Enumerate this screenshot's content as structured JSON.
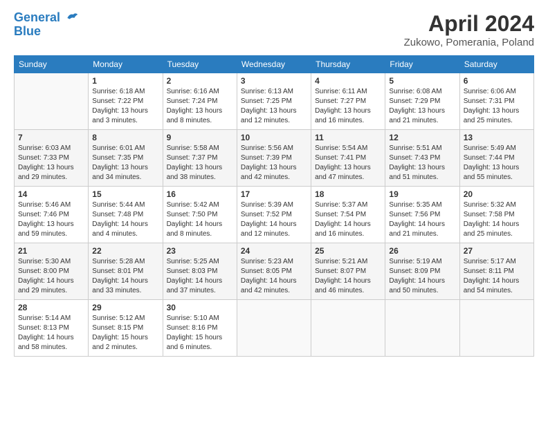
{
  "header": {
    "logo_line1": "General",
    "logo_line2": "Blue",
    "title": "April 2024",
    "subtitle": "Zukowo, Pomerania, Poland"
  },
  "calendar": {
    "days_of_week": [
      "Sunday",
      "Monday",
      "Tuesday",
      "Wednesday",
      "Thursday",
      "Friday",
      "Saturday"
    ],
    "weeks": [
      [
        {
          "day": "",
          "info": ""
        },
        {
          "day": "1",
          "info": "Sunrise: 6:18 AM\nSunset: 7:22 PM\nDaylight: 13 hours\nand 3 minutes."
        },
        {
          "day": "2",
          "info": "Sunrise: 6:16 AM\nSunset: 7:24 PM\nDaylight: 13 hours\nand 8 minutes."
        },
        {
          "day": "3",
          "info": "Sunrise: 6:13 AM\nSunset: 7:25 PM\nDaylight: 13 hours\nand 12 minutes."
        },
        {
          "day": "4",
          "info": "Sunrise: 6:11 AM\nSunset: 7:27 PM\nDaylight: 13 hours\nand 16 minutes."
        },
        {
          "day": "5",
          "info": "Sunrise: 6:08 AM\nSunset: 7:29 PM\nDaylight: 13 hours\nand 21 minutes."
        },
        {
          "day": "6",
          "info": "Sunrise: 6:06 AM\nSunset: 7:31 PM\nDaylight: 13 hours\nand 25 minutes."
        }
      ],
      [
        {
          "day": "7",
          "info": "Sunrise: 6:03 AM\nSunset: 7:33 PM\nDaylight: 13 hours\nand 29 minutes."
        },
        {
          "day": "8",
          "info": "Sunrise: 6:01 AM\nSunset: 7:35 PM\nDaylight: 13 hours\nand 34 minutes."
        },
        {
          "day": "9",
          "info": "Sunrise: 5:58 AM\nSunset: 7:37 PM\nDaylight: 13 hours\nand 38 minutes."
        },
        {
          "day": "10",
          "info": "Sunrise: 5:56 AM\nSunset: 7:39 PM\nDaylight: 13 hours\nand 42 minutes."
        },
        {
          "day": "11",
          "info": "Sunrise: 5:54 AM\nSunset: 7:41 PM\nDaylight: 13 hours\nand 47 minutes."
        },
        {
          "day": "12",
          "info": "Sunrise: 5:51 AM\nSunset: 7:43 PM\nDaylight: 13 hours\nand 51 minutes."
        },
        {
          "day": "13",
          "info": "Sunrise: 5:49 AM\nSunset: 7:44 PM\nDaylight: 13 hours\nand 55 minutes."
        }
      ],
      [
        {
          "day": "14",
          "info": "Sunrise: 5:46 AM\nSunset: 7:46 PM\nDaylight: 13 hours\nand 59 minutes."
        },
        {
          "day": "15",
          "info": "Sunrise: 5:44 AM\nSunset: 7:48 PM\nDaylight: 14 hours\nand 4 minutes."
        },
        {
          "day": "16",
          "info": "Sunrise: 5:42 AM\nSunset: 7:50 PM\nDaylight: 14 hours\nand 8 minutes."
        },
        {
          "day": "17",
          "info": "Sunrise: 5:39 AM\nSunset: 7:52 PM\nDaylight: 14 hours\nand 12 minutes."
        },
        {
          "day": "18",
          "info": "Sunrise: 5:37 AM\nSunset: 7:54 PM\nDaylight: 14 hours\nand 16 minutes."
        },
        {
          "day": "19",
          "info": "Sunrise: 5:35 AM\nSunset: 7:56 PM\nDaylight: 14 hours\nand 21 minutes."
        },
        {
          "day": "20",
          "info": "Sunrise: 5:32 AM\nSunset: 7:58 PM\nDaylight: 14 hours\nand 25 minutes."
        }
      ],
      [
        {
          "day": "21",
          "info": "Sunrise: 5:30 AM\nSunset: 8:00 PM\nDaylight: 14 hours\nand 29 minutes."
        },
        {
          "day": "22",
          "info": "Sunrise: 5:28 AM\nSunset: 8:01 PM\nDaylight: 14 hours\nand 33 minutes."
        },
        {
          "day": "23",
          "info": "Sunrise: 5:25 AM\nSunset: 8:03 PM\nDaylight: 14 hours\nand 37 minutes."
        },
        {
          "day": "24",
          "info": "Sunrise: 5:23 AM\nSunset: 8:05 PM\nDaylight: 14 hours\nand 42 minutes."
        },
        {
          "day": "25",
          "info": "Sunrise: 5:21 AM\nSunset: 8:07 PM\nDaylight: 14 hours\nand 46 minutes."
        },
        {
          "day": "26",
          "info": "Sunrise: 5:19 AM\nSunset: 8:09 PM\nDaylight: 14 hours\nand 50 minutes."
        },
        {
          "day": "27",
          "info": "Sunrise: 5:17 AM\nSunset: 8:11 PM\nDaylight: 14 hours\nand 54 minutes."
        }
      ],
      [
        {
          "day": "28",
          "info": "Sunrise: 5:14 AM\nSunset: 8:13 PM\nDaylight: 14 hours\nand 58 minutes."
        },
        {
          "day": "29",
          "info": "Sunrise: 5:12 AM\nSunset: 8:15 PM\nDaylight: 15 hours\nand 2 minutes."
        },
        {
          "day": "30",
          "info": "Sunrise: 5:10 AM\nSunset: 8:16 PM\nDaylight: 15 hours\nand 6 minutes."
        },
        {
          "day": "",
          "info": ""
        },
        {
          "day": "",
          "info": ""
        },
        {
          "day": "",
          "info": ""
        },
        {
          "day": "",
          "info": ""
        }
      ]
    ]
  }
}
